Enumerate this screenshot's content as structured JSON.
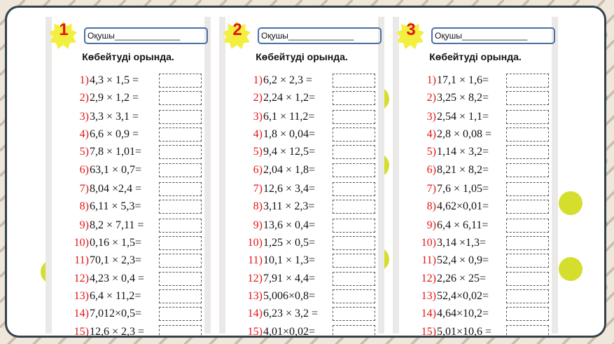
{
  "worksheets": [
    {
      "number": "1",
      "name_label": "Оқушы______________",
      "title": "Көбейтуді орында.",
      "exercises": [
        {
          "n": "1)",
          "expr": "4,3 × 1,5 ="
        },
        {
          "n": "2)",
          "expr": "2,9 × 1,2 ="
        },
        {
          "n": "3)",
          "expr": "3,3 × 3,1 ="
        },
        {
          "n": "4)",
          "expr": "6,6 × 0,9 ="
        },
        {
          "n": "5)",
          "expr": "7,8 × 1,01="
        },
        {
          "n": "6)",
          "expr": "63,1 × 0,7="
        },
        {
          "n": "7)",
          "expr": "8,04 ×2,4 ="
        },
        {
          "n": "8)",
          "expr": "6,11 × 5,3="
        },
        {
          "n": "9)",
          "expr": "8,2 × 7,11 ="
        },
        {
          "n": "10)",
          "expr": "0,16 × 1,5="
        },
        {
          "n": "11)",
          "expr": "70,1 × 2,3="
        },
        {
          "n": "12)",
          "expr": "4,23 × 0,4 ="
        },
        {
          "n": "13)",
          "expr": "6,4 × 11,2="
        },
        {
          "n": "14)",
          "expr": "7,012×0,5="
        },
        {
          "n": "15)",
          "expr": "12,6 × 2,3 ="
        }
      ]
    },
    {
      "number": "2",
      "name_label": "Оқушы______________",
      "title": "Көбейтуді орында.",
      "exercises": [
        {
          "n": "1)",
          "expr": "6,2 × 2,3 ="
        },
        {
          "n": "2)",
          "expr": "2,24 × 1,2="
        },
        {
          "n": "3)",
          "expr": "6,1 × 11,2="
        },
        {
          "n": "4)",
          "expr": "1,8 × 0,04="
        },
        {
          "n": "5)",
          "expr": "9,4 × 12,5="
        },
        {
          "n": "6)",
          "expr": "2,04 × 1,8="
        },
        {
          "n": "7)",
          "expr": "12,6 × 3,4="
        },
        {
          "n": "8)",
          "expr": "3,11 × 2,3="
        },
        {
          "n": "9)",
          "expr": "13,6 × 0,4="
        },
        {
          "n": "10)",
          "expr": "1,25 × 0,5="
        },
        {
          "n": "11)",
          "expr": "10,1 × 1,3="
        },
        {
          "n": "12)",
          "expr": "7,91 × 4,4="
        },
        {
          "n": "13)",
          "expr": "5,006×0,8="
        },
        {
          "n": "14)",
          "expr": "6,23 × 3,2 ="
        },
        {
          "n": "15)",
          "expr": "4,01×0,02="
        }
      ]
    },
    {
      "number": "3",
      "name_label": "Оқушы______________",
      "title": "Көбейтуді орында.",
      "exercises": [
        {
          "n": "1)",
          "expr": "17,1 × 1,6="
        },
        {
          "n": "2)",
          "expr": "3,25 × 8,2="
        },
        {
          "n": "3)",
          "expr": "2,54 × 1,1="
        },
        {
          "n": "4)",
          "expr": "2,8 × 0,08 ="
        },
        {
          "n": "5)",
          "expr": "1,14 × 3,2="
        },
        {
          "n": "6)",
          "expr": "8,21 × 8,2="
        },
        {
          "n": "7)",
          "expr": "7,6 × 1,05="
        },
        {
          "n": "8)",
          "expr": "4,62×0,01="
        },
        {
          "n": "9)",
          "expr": "6,4 × 6,11="
        },
        {
          "n": "10)",
          "expr": "3,14 ×1,3="
        },
        {
          "n": "11)",
          "expr": "52,4 × 0,9="
        },
        {
          "n": "12)",
          "expr": "2,26 × 25="
        },
        {
          "n": "13)",
          "expr": "52,4×0,02="
        },
        {
          "n": "14)",
          "expr": "4,64×10,2="
        },
        {
          "n": "15)",
          "expr": "5,01×10,6 ="
        }
      ]
    }
  ],
  "colors": {
    "number_red": "#e01616",
    "badge_yellow": "#f3ef3e",
    "frame_border": "#33424b",
    "name_box_border": "#4b6fa8",
    "accent_circles": "#d5de2d"
  }
}
